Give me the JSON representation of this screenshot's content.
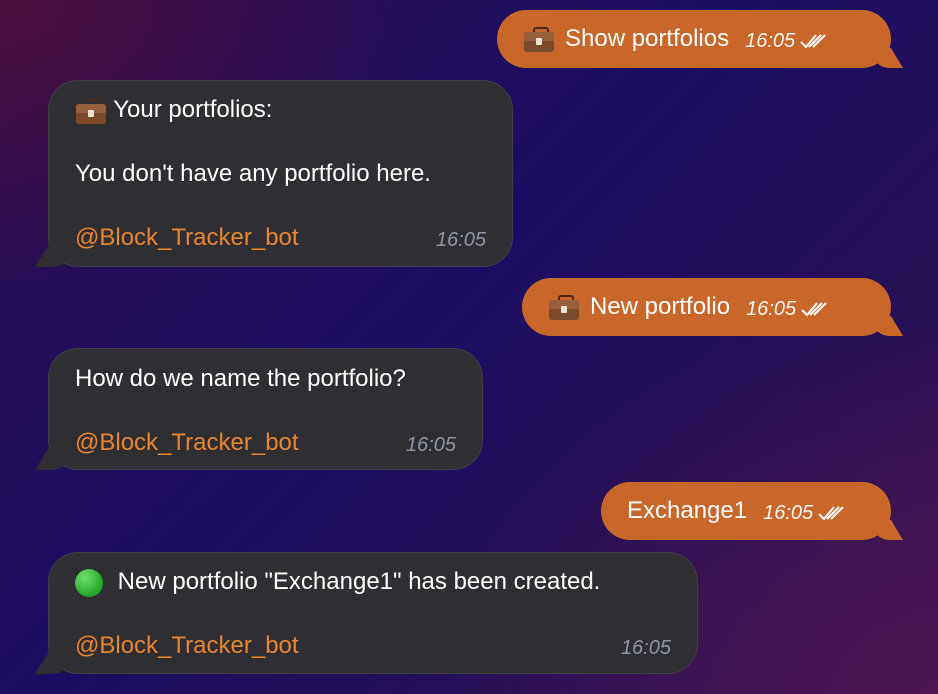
{
  "messages": [
    {
      "id": "m1",
      "side": "out",
      "icon": "briefcase-icon",
      "text": "Show portfolios",
      "time": "16:05"
    },
    {
      "id": "m2",
      "side": "in",
      "icon": "briefcase-icon",
      "lines": [
        "Your portfolios:",
        "You don't have any portfolio here."
      ],
      "sender": "@Block_Tracker_bot",
      "time": "16:05"
    },
    {
      "id": "m3",
      "side": "out",
      "icon": "briefcase-icon",
      "text": "New portfolio",
      "time": "16:05"
    },
    {
      "id": "m4",
      "side": "in",
      "lines": [
        "How do we name the portfolio?"
      ],
      "sender": "@Block_Tracker_bot",
      "time": "16:05"
    },
    {
      "id": "m5",
      "side": "out",
      "text": "Exchange1",
      "time": "16:05"
    },
    {
      "id": "m6",
      "side": "in",
      "icon": "green-circle-icon",
      "lines": [
        "New portfolio \"Exchange1\" has been created."
      ],
      "sender": "@Block_Tracker_bot",
      "time": "16:05"
    }
  ],
  "colors": {
    "outgoing_bubble": "#c9662a",
    "incoming_bubble": "#2f2f33",
    "sender_link": "#e8852f",
    "incoming_time": "#8f94a8"
  }
}
